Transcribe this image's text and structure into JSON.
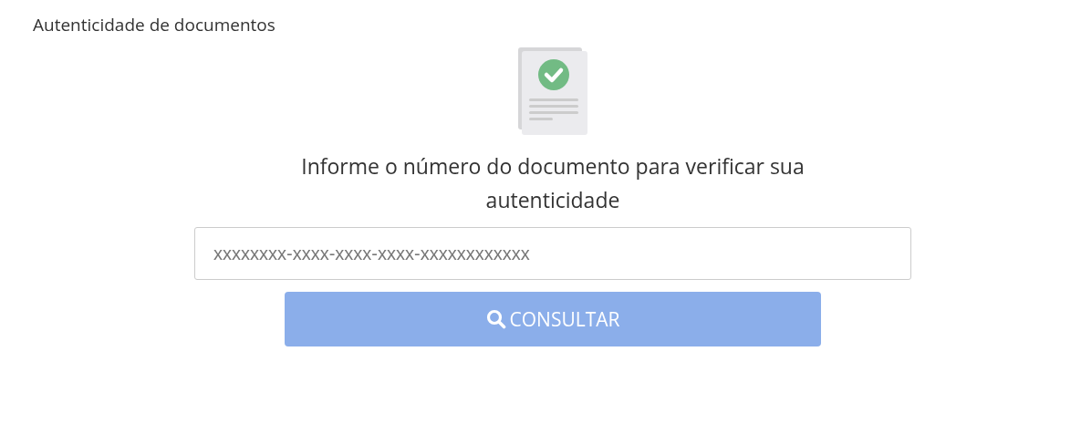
{
  "page_title": "Autenticidade de documentos",
  "heading": "Informe o número do documento para verificar sua autenticidade",
  "document_field": {
    "placeholder": "xxxxxxxx-xxxx-xxxx-xxxx-xxxxxxxxxxxx"
  },
  "submit_button": {
    "label": "CONSULTAR",
    "disabled": true
  }
}
